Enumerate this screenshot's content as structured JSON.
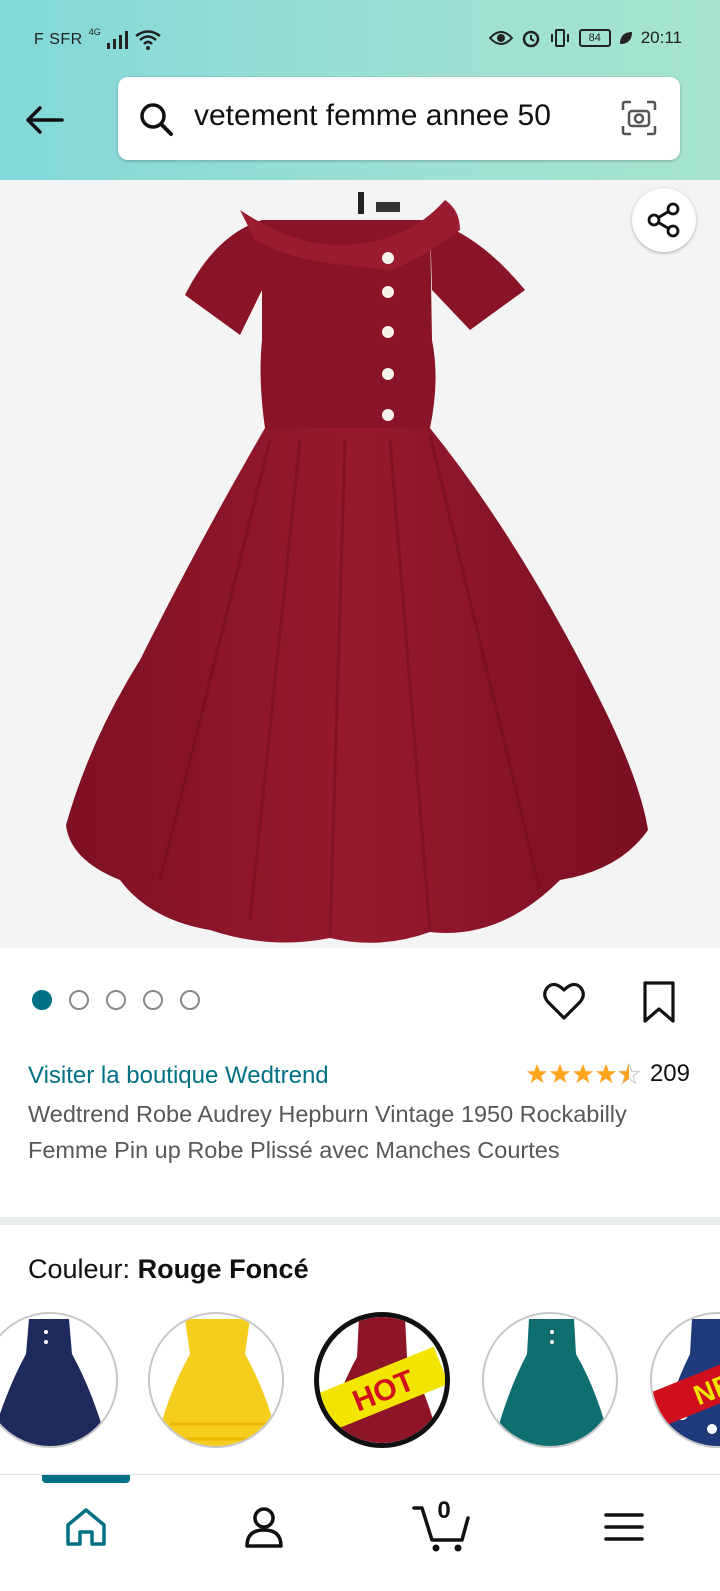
{
  "status_bar": {
    "carrier": "F SFR",
    "network": "4G",
    "battery": "84",
    "time": "20:11"
  },
  "search": {
    "query": "vetement femme annee 50"
  },
  "product": {
    "store_link": "Visiter la boutique Wedtrend",
    "rating_value": 4.5,
    "rating_count": "209",
    "title": "Wedtrend Robe Audrey Hepburn Vintage 1950 Rockabilly Femme Pin up Robe Plissé avec Manches Courtes",
    "image_count": 5,
    "active_image_index": 0
  },
  "color": {
    "label": "Couleur:",
    "selected": "Rouge Foncé",
    "swatches": [
      {
        "color": "#1f2a5c",
        "badge": ""
      },
      {
        "color": "#f5cd1c",
        "badge": ""
      },
      {
        "color": "#8e1528",
        "badge": "HOT"
      },
      {
        "color": "#0f6e6e",
        "badge": ""
      },
      {
        "color": "#ffffff",
        "badge": "NE"
      }
    ]
  },
  "bottom_nav": {
    "cart_count": "0"
  },
  "colors": {
    "accent": "#007185",
    "star": "#ffa41c",
    "dress": "#8e1528"
  }
}
